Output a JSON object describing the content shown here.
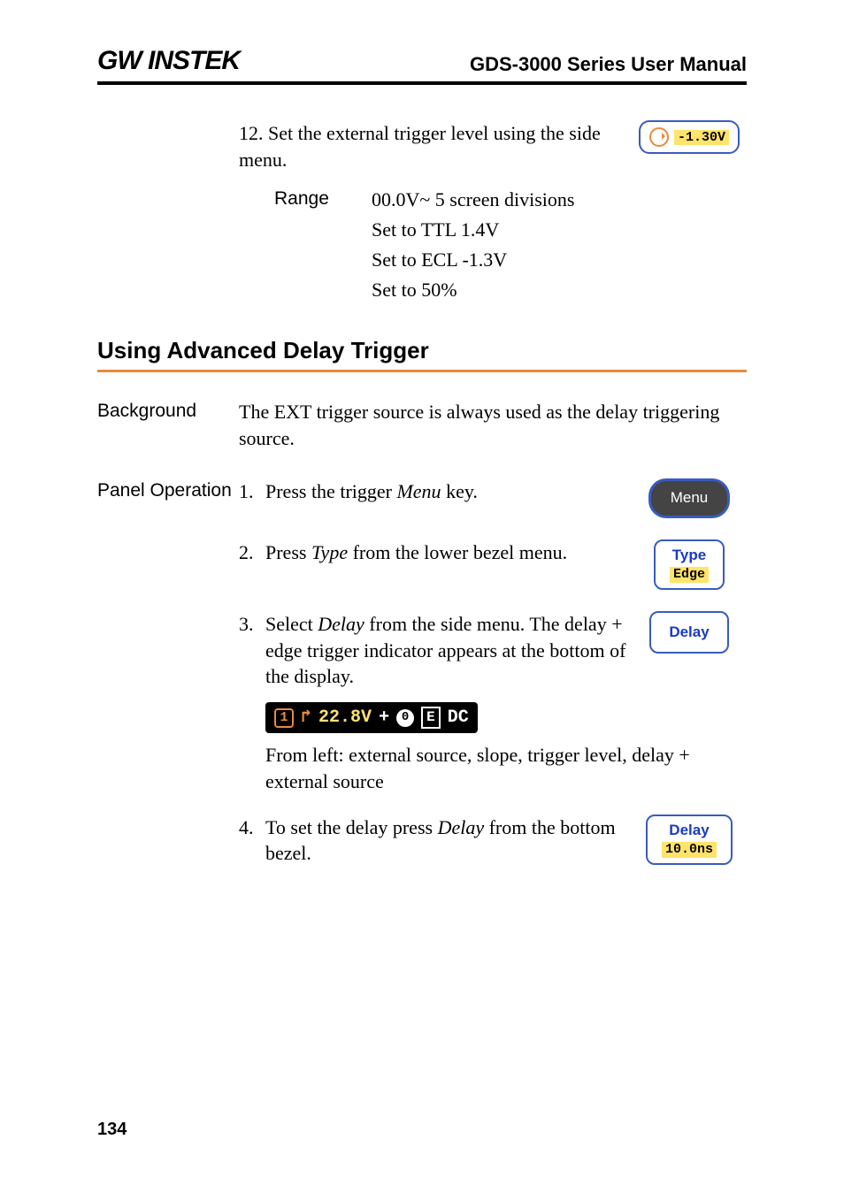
{
  "header": {
    "logo": "GW INSTEK",
    "title": "GDS-3000 Series User Manual"
  },
  "step12": {
    "num": "12.",
    "text_a": "Set the external trigger level using the side menu.",
    "knob_value": "-1.30V"
  },
  "range": {
    "label": "Range",
    "lines": [
      "00.0V~ 5 screen divisions",
      "Set to TTL 1.4V",
      "Set to ECL -1.3V",
      "Set to 50%"
    ]
  },
  "section_heading": "Using Advanced Delay Trigger",
  "background": {
    "label": "Background",
    "text": "The EXT trigger source is always used as the delay triggering source."
  },
  "panel_op": {
    "label": "Panel Operation",
    "steps": {
      "s1": {
        "num": "1.",
        "pre": "Press the trigger ",
        "kw": "Menu",
        "post": " key.",
        "btn": "Menu"
      },
      "s2": {
        "num": "2.",
        "pre": "Press ",
        "kw": "Type",
        "post": " from the lower bezel menu.",
        "btn_top": "Type",
        "btn_sel": "Edge"
      },
      "s3": {
        "num": "3.",
        "pre": "Select ",
        "kw": "Delay",
        "post": " from the side menu. The delay + edge trigger indicator appears at the bottom of the display.",
        "btn": "Delay"
      },
      "s4": {
        "num": "4.",
        "pre": "To set the delay press ",
        "kw": "Delay",
        "post": " from the bottom bezel.",
        "btn_top": "Delay",
        "btn_sel": "10.0ns"
      }
    }
  },
  "indicator": {
    "src": "1",
    "level": "22.8V",
    "plus": "+",
    "zero": "0",
    "e": "E",
    "dc": "DC",
    "caption": "From left: external source, slope, trigger level, delay + external source"
  },
  "page_number": "134"
}
